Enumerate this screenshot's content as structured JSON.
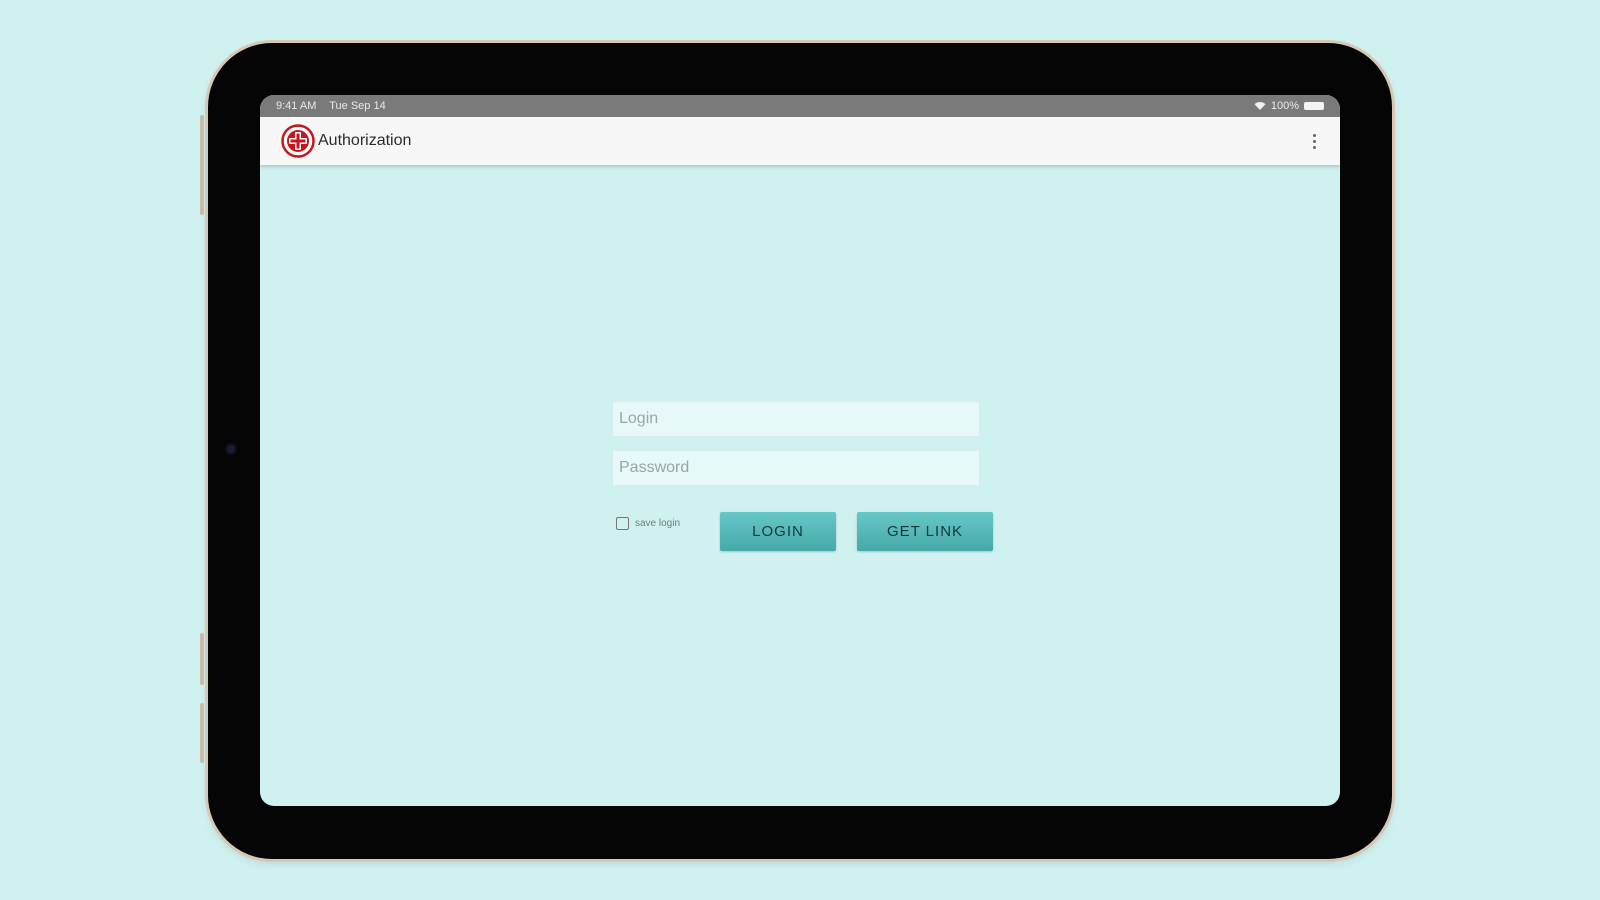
{
  "status_bar": {
    "time": "9:41 AM",
    "date": "Tue Sep 14",
    "battery": "100%"
  },
  "app_bar": {
    "title": "Authorization",
    "menu_icon": "more-vert-icon",
    "logo_icon": "red-cross-logo"
  },
  "form": {
    "login_placeholder": "Login",
    "login_value": "",
    "password_placeholder": "Password",
    "password_value": "",
    "save_login_label": "save login",
    "save_login_checked": false,
    "login_button": "LOGIN",
    "get_link_button": "GET LINK"
  },
  "colors": {
    "background": "#cff2f1",
    "accent": "#4fb5b4",
    "logo_red": "#c4161c"
  }
}
